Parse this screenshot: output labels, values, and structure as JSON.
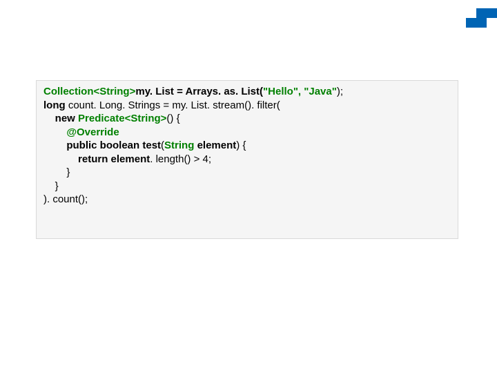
{
  "code": {
    "l1a": "Collection<String>",
    "l1b": "my. List = Arrays. as. List(",
    "l1c": "\"Hello\", \"Java\"",
    "l1d": ");",
    "l2a": "long",
    "l2b": " count. Long. Strings = my. List. stream(). filter(",
    "l3a": "    ",
    "l3b": "new",
    "l3c": " ",
    "l3d": "Predicate<String>",
    "l3e": "() {",
    "l4a": "        ",
    "l4b": "@Override",
    "l5a": "        ",
    "l5b": "public boolean",
    "l5c": " ",
    "l5d": "test",
    "l5e": "(",
    "l5f": "String",
    "l5g": " ",
    "l5h": "element",
    "l5i": ") {",
    "l6a": "            ",
    "l6b": "return",
    "l6c": " ",
    "l6d": "element",
    "l6e": ". length() > 4;",
    "l7a": "        ",
    "l7b": "}",
    "l8a": "    ",
    "l8b": "}",
    "l9": "). count();"
  }
}
